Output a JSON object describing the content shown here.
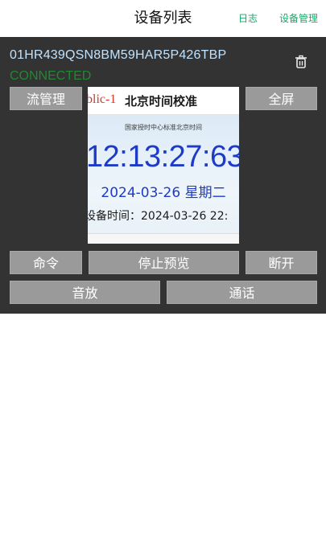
{
  "header": {
    "title": "设备列表",
    "log_link": "日志",
    "device_mgmt_link": "设备管理"
  },
  "device": {
    "id": "01HR439QSN8BM59HAR5P426TBP",
    "status": "CONNECTED",
    "delete_icon": "trash-icon"
  },
  "buttons": {
    "stream_mgmt": "流管理",
    "fullscreen": "全屏",
    "command": "命令",
    "stop_preview": "停止预览",
    "disconnect": "断开",
    "audio": "音放",
    "call": "通话"
  },
  "preview": {
    "header_red": "blic-1",
    "header_title": "北京时间校准",
    "subtitle": "国家授时中心标准北京时间",
    "time": "12:13:27:63",
    "date": "2024-03-26 星期二",
    "device_time": "设备时间：2024-03-26 22:"
  },
  "colors": {
    "accent_green": "#1aa86a",
    "status_green": "#1f8a2f",
    "panel_bg": "#333333",
    "button_bg": "#9a9a9a"
  }
}
